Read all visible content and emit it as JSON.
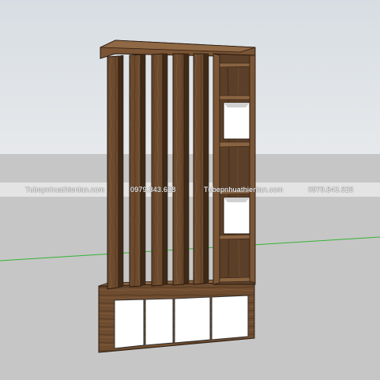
{
  "watermark": {
    "texts": [
      "Tubepnhuathienlan.com",
      "0979.843.628",
      "Tubepnhuathienlan.com",
      "0979.843.628"
    ]
  },
  "scene": {
    "subject": "room-divider-shelf",
    "colors": {
      "sky": "#dde3e8",
      "ground": "#c7c7c7",
      "horizon_band": "#e6e6e6",
      "axis_line": "#2fb32f",
      "wood_dark": "#4a3320",
      "wood_mid": "#6b4a2e",
      "wood_light": "#8a6240",
      "door_white": "#ffffff",
      "shelf_back": "#5a3e27"
    }
  }
}
